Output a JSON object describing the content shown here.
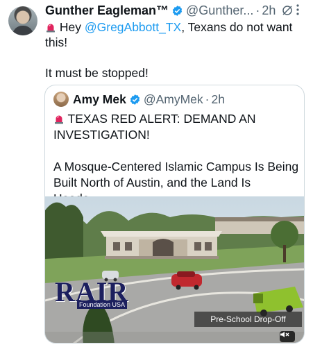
{
  "tweet": {
    "display_name": "Gunther Eagleman™",
    "handle": "@Gunther...",
    "separator": "·",
    "time": "2h",
    "more": "···",
    "text_prefix": " Hey ",
    "mention": "@GregAbbott_TX",
    "text_suffix": ", Texans do not want this!",
    "text_para2": "It must be stopped!"
  },
  "quote": {
    "display_name": "Amy Mek",
    "handle": "@AmyMek",
    "separator": "·",
    "time": "2h",
    "headline": " TEXAS RED ALERT: DEMAND AN INVESTIGATION!",
    "body": "A Mosque-Centered Islamic Campus Is Being Built North of Austin, and the Land Is Heade...",
    "media": {
      "watermark_logo": "RAIR",
      "watermark_sub": "Foundation USA",
      "caption": "Pre-School Drop-Off"
    }
  },
  "colors": {
    "link": "#1d9bf0",
    "verified": "#1d9bf0",
    "secondary_text": "#536471",
    "siren": "#e0245e"
  },
  "icons": [
    "verified-badge-icon",
    "grok-icon",
    "more-icon",
    "siren-icon",
    "mute-icon"
  ]
}
